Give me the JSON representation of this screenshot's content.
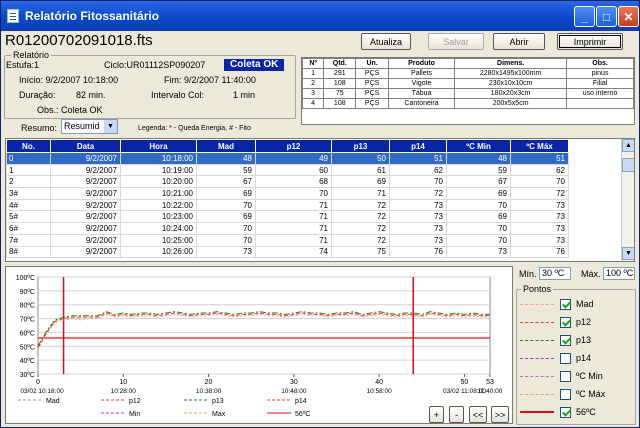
{
  "window": {
    "title": "Relatório Fitossanitário",
    "min": "_",
    "max": "□",
    "close": "✕"
  },
  "file": "R01200702091018.fts",
  "toolbar": {
    "atualiza": "Atualiza",
    "salvar": "Salvar",
    "abrir": "Abrir",
    "imprimir": "Imprimir"
  },
  "relatorio": {
    "group": "Relatório",
    "estufa": "Estufa:1",
    "ciclo": "Ciclo:UR01112SP090207",
    "status": "Coleta OK",
    "inicio": "Início: 9/2/2007 10:18:00",
    "fim": "Fim: 9/2/2007 11:40:00",
    "duracao_label": "Duração:",
    "duracao": "82 min.",
    "intervalo_label": "Intervalo Col:",
    "intervalo": "1 min",
    "obs": "Obs.: Coleta OK"
  },
  "resumo": {
    "label": "Resumo:",
    "value": "Resumid",
    "legenda": "Legenda: * - Queda Energia,  # - Fito"
  },
  "products": {
    "headers": [
      "Nº",
      "Qtd.",
      "Un.",
      "Produto",
      "Dimens.",
      "Obs."
    ],
    "rows": [
      [
        "1",
        "291",
        "PÇS",
        "Pallets",
        "2280x1495x100mm",
        "pinus"
      ],
      [
        "2",
        "108",
        "PÇS",
        "Vigote",
        "230x10x10cm",
        "Filial"
      ],
      [
        "3",
        "75",
        "PÇS",
        "Tábua",
        "180x20x3cm",
        "uso interno"
      ],
      [
        "4",
        "108",
        "PÇS",
        "Cantoneira",
        "200x5x5cm",
        ""
      ]
    ]
  },
  "table": {
    "headers": [
      "No.",
      "Data",
      "Hora",
      "Mad",
      "p12",
      "p13",
      "p14",
      "ºC Min",
      "ºC Máx"
    ],
    "rows": [
      [
        "0",
        "9/2/2007",
        "10:18:00",
        "48",
        "49",
        "50",
        "51",
        "48",
        "51"
      ],
      [
        "1",
        "9/2/2007",
        "10:19:00",
        "59",
        "60",
        "61",
        "62",
        "59",
        "62"
      ],
      [
        "2",
        "9/2/2007",
        "10:20:00",
        "67",
        "68",
        "69",
        "70",
        "67",
        "70"
      ],
      [
        "3#",
        "9/2/2007",
        "10:21:00",
        "69",
        "70",
        "71",
        "72",
        "69",
        "72"
      ],
      [
        "4#",
        "9/2/2007",
        "10:22:00",
        "70",
        "71",
        "72",
        "73",
        "70",
        "73"
      ],
      [
        "5#",
        "9/2/2007",
        "10:23:00",
        "69",
        "71",
        "72",
        "73",
        "69",
        "73"
      ],
      [
        "6#",
        "9/2/2007",
        "10:24:00",
        "70",
        "71",
        "72",
        "73",
        "70",
        "73"
      ],
      [
        "7#",
        "9/2/2007",
        "10:25:00",
        "70",
        "71",
        "72",
        "73",
        "70",
        "73"
      ],
      [
        "8#",
        "9/2/2007",
        "10:26:00",
        "73",
        "74",
        "75",
        "76",
        "73",
        "76"
      ]
    ]
  },
  "range": {
    "min_label": "Mín.",
    "min": "30 ºC",
    "max_label": "Máx.",
    "max": "100 ºC"
  },
  "pontos": {
    "group": "Pontos",
    "items": [
      {
        "label": "Mad",
        "color": "#ff9a9a",
        "checked": true
      },
      {
        "label": "p12",
        "color": "#ff3030",
        "checked": true
      },
      {
        "label": "p13",
        "color": "#208020",
        "checked": true
      },
      {
        "label": "p14",
        "color": "#cc20cc",
        "checked": false
      },
      {
        "label": "ºC Min",
        "color": "#cc60cc",
        "checked": false
      },
      {
        "label": "ºC Máx",
        "color": "#e0a060",
        "checked": false
      },
      {
        "label": "56ºC",
        "color": "#e01010",
        "checked": true
      }
    ]
  },
  "nav": {
    "plus": "+",
    "minus": "-",
    "prev": "<<",
    "next": ">>"
  },
  "chart_data": {
    "type": "line",
    "yticks": [
      "100ºC",
      "90ºC",
      "80ºC",
      "70ºC",
      "60ºC",
      "50ºC",
      "40ºC",
      "30ºC"
    ],
    "ylim": [
      30,
      100
    ],
    "xticks": [
      {
        "i": 0,
        "top": "0",
        "bottom": "03/02 10:18:00"
      },
      {
        "i": 10,
        "top": "10",
        "bottom": "10:28:00"
      },
      {
        "i": 20,
        "top": "20",
        "bottom": "10:38:00"
      },
      {
        "i": 30,
        "top": "30",
        "bottom": "10:48:00"
      },
      {
        "i": 40,
        "top": "40",
        "bottom": "10:58:00"
      },
      {
        "i": 50,
        "top": "50",
        "bottom": "03/02 11:08:00"
      },
      {
        "i": 53,
        "top": "53",
        "bottom": "11:40:00"
      }
    ],
    "xlim": [
      0,
      53
    ],
    "threshold": 56,
    "markers": [
      3,
      44
    ],
    "legend": [
      "Mad",
      "p12",
      "p13",
      "p14",
      "Min",
      "Max",
      "56ºC"
    ],
    "series": [
      {
        "name": "Mad",
        "color": "#ff9a9a",
        "values": [
          48,
          59,
          67,
          69,
          70,
          69,
          70,
          70,
          73,
          71,
          72,
          71,
          72,
          72,
          71,
          72,
          73,
          72,
          71,
          72,
          72,
          73,
          72,
          71,
          72,
          72,
          73,
          72,
          72,
          71,
          72,
          73,
          72,
          72,
          71,
          72,
          72,
          73,
          71,
          72,
          73,
          72,
          71,
          72,
          72,
          71,
          73,
          72,
          71,
          72,
          71,
          72,
          71,
          71
        ]
      },
      {
        "name": "p12",
        "color": "#ff3030",
        "values": [
          49,
          60,
          68,
          70,
          71,
          71,
          71,
          71,
          74,
          72,
          73,
          72,
          73,
          73,
          72,
          73,
          74,
          73,
          72,
          73,
          73,
          74,
          73,
          72,
          73,
          73,
          74,
          73,
          73,
          72,
          73,
          74,
          73,
          73,
          72,
          73,
          73,
          74,
          72,
          73,
          74,
          73,
          72,
          73,
          73,
          72,
          74,
          73,
          72,
          73,
          72,
          73,
          72,
          72
        ]
      },
      {
        "name": "p13",
        "color": "#208020",
        "values": [
          50,
          61,
          69,
          71,
          72,
          72,
          72,
          72,
          75,
          73,
          74,
          73,
          74,
          74,
          73,
          74,
          75,
          74,
          73,
          74,
          74,
          75,
          74,
          73,
          74,
          74,
          75,
          74,
          74,
          73,
          74,
          75,
          74,
          74,
          73,
          74,
          74,
          75,
          73,
          74,
          75,
          74,
          73,
          74,
          74,
          73,
          75,
          74,
          73,
          74,
          73,
          74,
          73,
          73
        ]
      }
    ]
  }
}
